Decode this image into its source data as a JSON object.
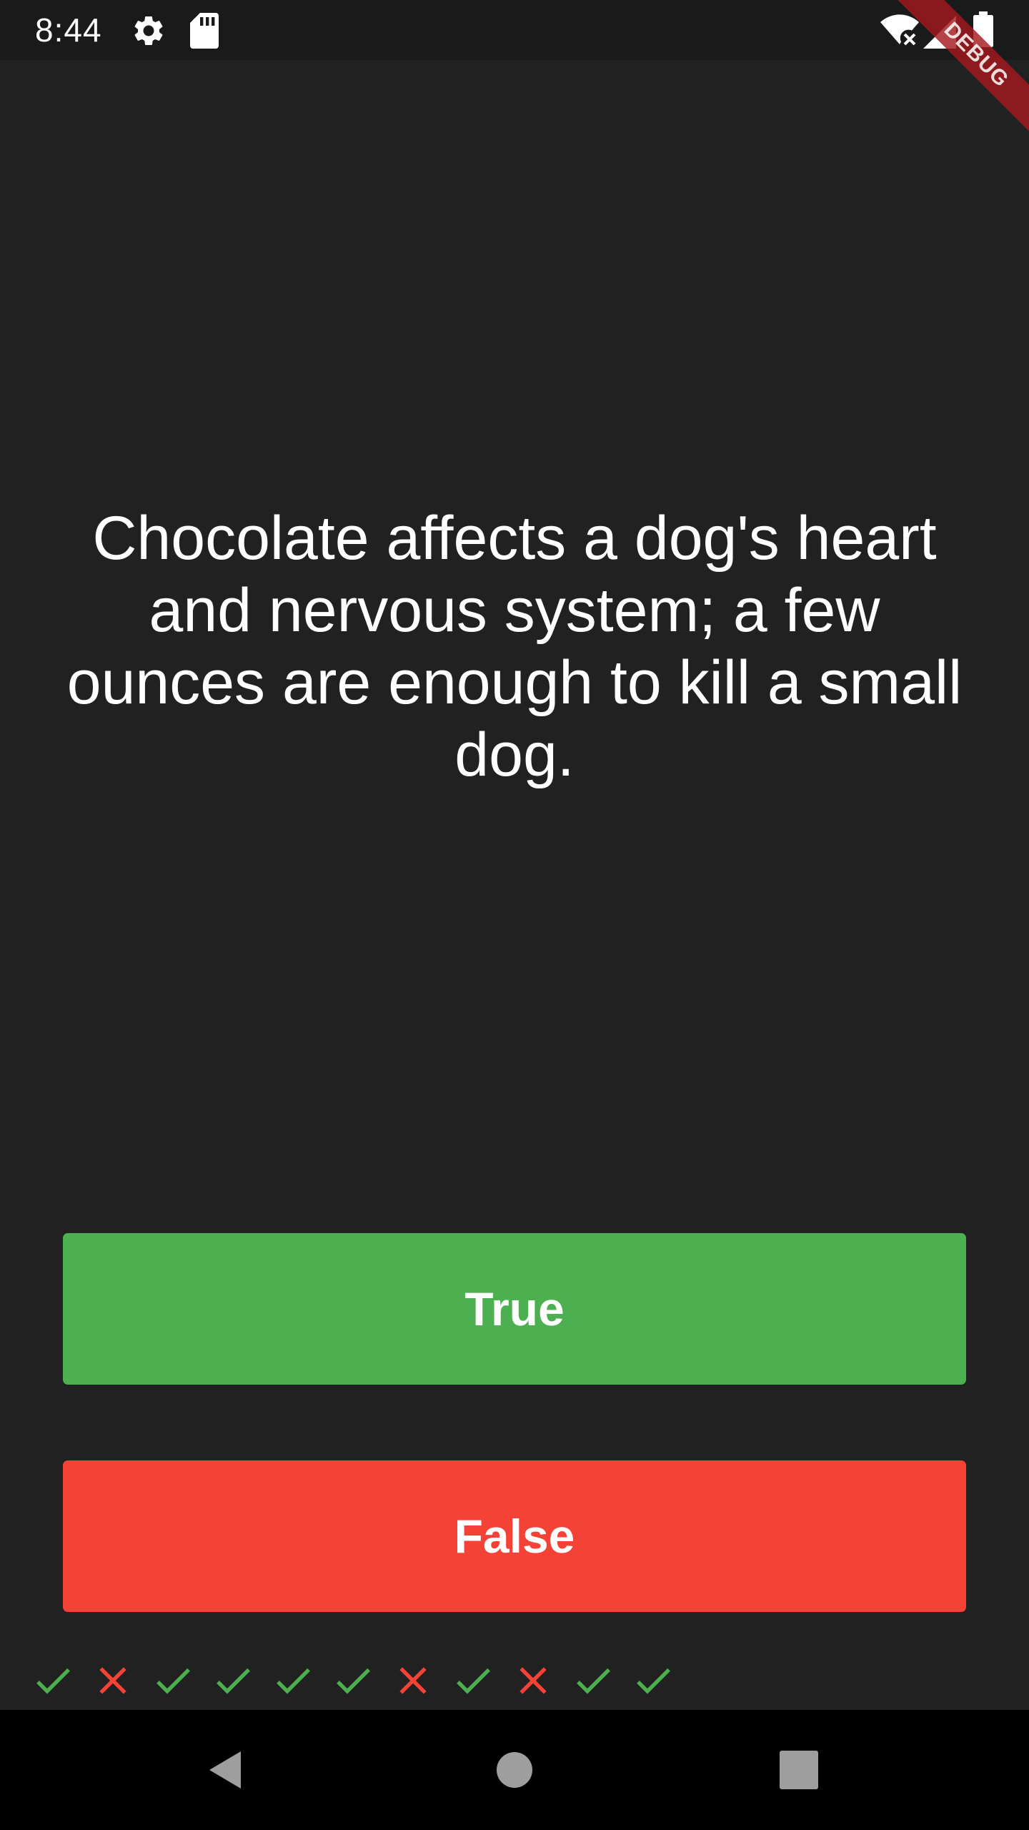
{
  "status_bar": {
    "time": "8:44",
    "left_icons": [
      "gear-icon",
      "sd-card-icon"
    ],
    "right_icons": [
      "wifi-off-icon",
      "signal-icon",
      "battery-icon"
    ]
  },
  "debug_banner": {
    "label": "DEBUG"
  },
  "quiz": {
    "question": "Chocolate affects a dog's heart and nervous system; a few ounces are enough to kill a small dog.",
    "true_label": "True",
    "false_label": "False"
  },
  "score_keeper": [
    {
      "result": "correct",
      "icon": "check-icon",
      "color": "#4caf50"
    },
    {
      "result": "wrong",
      "icon": "close-icon",
      "color": "#f44336"
    },
    {
      "result": "correct",
      "icon": "check-icon",
      "color": "#4caf50"
    },
    {
      "result": "correct",
      "icon": "check-icon",
      "color": "#4caf50"
    },
    {
      "result": "correct",
      "icon": "check-icon",
      "color": "#4caf50"
    },
    {
      "result": "correct",
      "icon": "check-icon",
      "color": "#4caf50"
    },
    {
      "result": "wrong",
      "icon": "close-icon",
      "color": "#f44336"
    },
    {
      "result": "correct",
      "icon": "check-icon",
      "color": "#4caf50"
    },
    {
      "result": "wrong",
      "icon": "close-icon",
      "color": "#f44336"
    },
    {
      "result": "correct",
      "icon": "check-icon",
      "color": "#4caf50"
    },
    {
      "result": "correct",
      "icon": "check-icon",
      "color": "#4caf50"
    }
  ],
  "colors": {
    "background": "#212121",
    "true_button": "#4caf50",
    "false_button": "#f44336",
    "correct_mark": "#4caf50",
    "wrong_mark": "#f44336"
  },
  "nav_bar": {
    "buttons": [
      "back-icon",
      "home-icon",
      "recents-icon"
    ]
  }
}
